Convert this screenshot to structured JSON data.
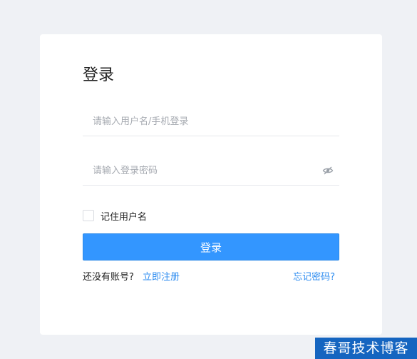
{
  "login": {
    "title": "登录",
    "username_placeholder": "请输入用户名/手机登录",
    "password_placeholder": "请输入登录密码",
    "remember_label": "记住用户名",
    "remember_checked": false,
    "submit_label": "登录",
    "no_account_text": "还没有账号?",
    "register_label": "立即注册",
    "forgot_label": "忘记密码?"
  },
  "icons": {
    "password_toggle": "eye-hidden-icon"
  },
  "colors": {
    "page_background": "#eff1f5",
    "primary_button": "#3396ff",
    "link": "#2d8cf0",
    "watermark_background": "#1565c0"
  },
  "watermark": {
    "text": "春哥技术博客"
  }
}
